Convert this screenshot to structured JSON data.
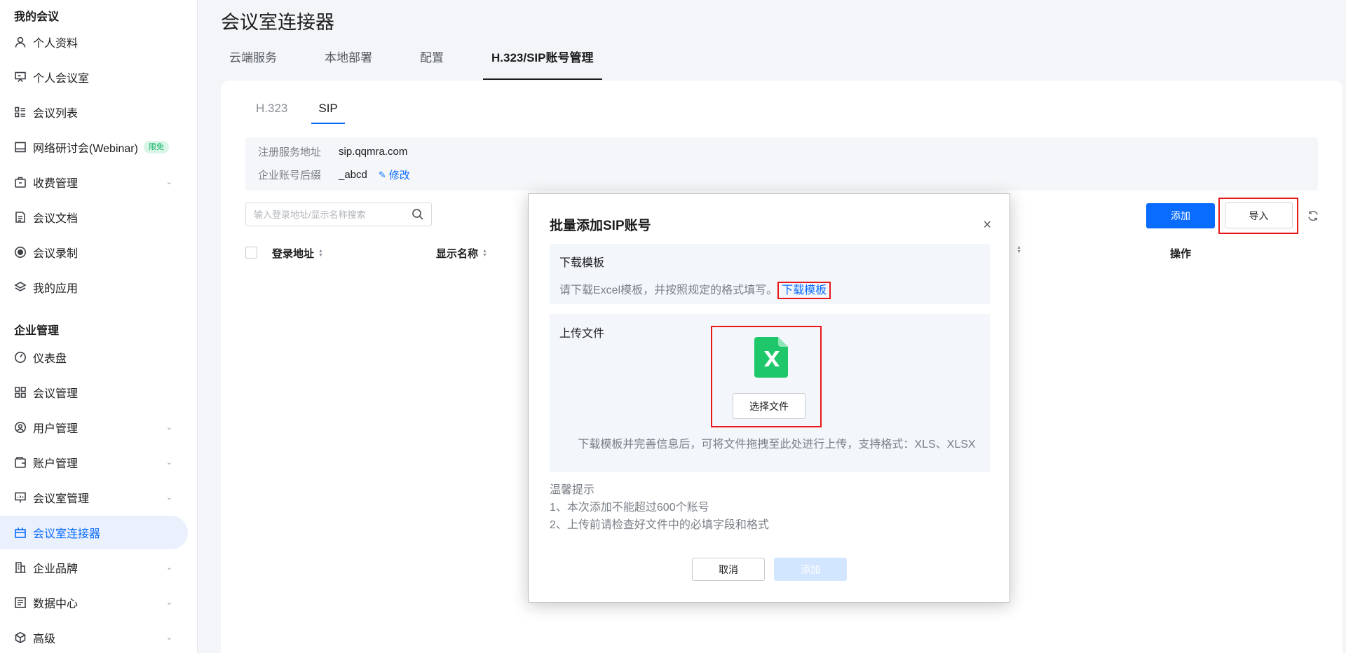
{
  "sidebar": {
    "section_my": "我的会议",
    "section_ent": "企业管理",
    "my_items": [
      {
        "label": "个人资料",
        "icon": "user-icon"
      },
      {
        "label": "个人会议室",
        "icon": "presentation-icon"
      },
      {
        "label": "会议列表",
        "icon": "list-icon"
      },
      {
        "label": "网络研讨会(Webinar)",
        "icon": "monitor-icon",
        "badge": "限免"
      },
      {
        "label": "收费管理",
        "icon": "briefcase-icon"
      },
      {
        "label": "会议文档",
        "icon": "document-icon"
      },
      {
        "label": "会议录制",
        "icon": "record-icon"
      },
      {
        "label": "我的应用",
        "icon": "layers-icon"
      }
    ],
    "ent_items": [
      {
        "label": "仪表盘",
        "icon": "dashboard-icon"
      },
      {
        "label": "会议管理",
        "icon": "grid-icon"
      },
      {
        "label": "用户管理",
        "icon": "user-circle-icon"
      },
      {
        "label": "账户管理",
        "icon": "wallet-icon"
      },
      {
        "label": "会议室管理",
        "icon": "screen-icon"
      },
      {
        "label": "会议室连接器",
        "icon": "connector-icon",
        "active": true
      },
      {
        "label": "企业品牌",
        "icon": "building-icon"
      },
      {
        "label": "数据中心",
        "icon": "data-icon"
      },
      {
        "label": "高级",
        "icon": "cube-icon"
      }
    ]
  },
  "page": {
    "title": "会议室连接器",
    "tabs": [
      "云端服务",
      "本地部署",
      "配置",
      "H.323/SIP账号管理"
    ],
    "subtabs": [
      "H.323",
      "SIP"
    ],
    "info": {
      "server_label": "注册服务地址",
      "server_value": "sip.qqmra.com",
      "suffix_label": "企业账号后缀",
      "suffix_value": "_abcd",
      "edit_label": "修改"
    },
    "search_placeholder": "输入登录地址/显示名称搜索",
    "add_label": "添加",
    "import_label": "导入",
    "columns": [
      "登录地址",
      "显示名称",
      "操作"
    ]
  },
  "modal": {
    "title": "批量添加SIP账号",
    "close": "×",
    "download_title": "下载模板",
    "download_desc": "请下载Excel模板，并按照规定的格式填写。",
    "download_link": "下载模板",
    "upload_title": "上传文件",
    "choose_label": "选择文件",
    "upload_hint": "下载模板并完善信息后，可将文件拖拽至此处进行上传，支持格式：XLS、XLSX",
    "tips_title": "温馨提示",
    "tip1": "1、本次添加不能超过600个账号",
    "tip2": "2、上传前请检查好文件中的必填字段和格式",
    "cancel_label": "取消",
    "confirm_label": "添加"
  },
  "colors": {
    "accent": "#0a6cff",
    "highlight": "#e81818",
    "excel": "#1ec86a"
  }
}
